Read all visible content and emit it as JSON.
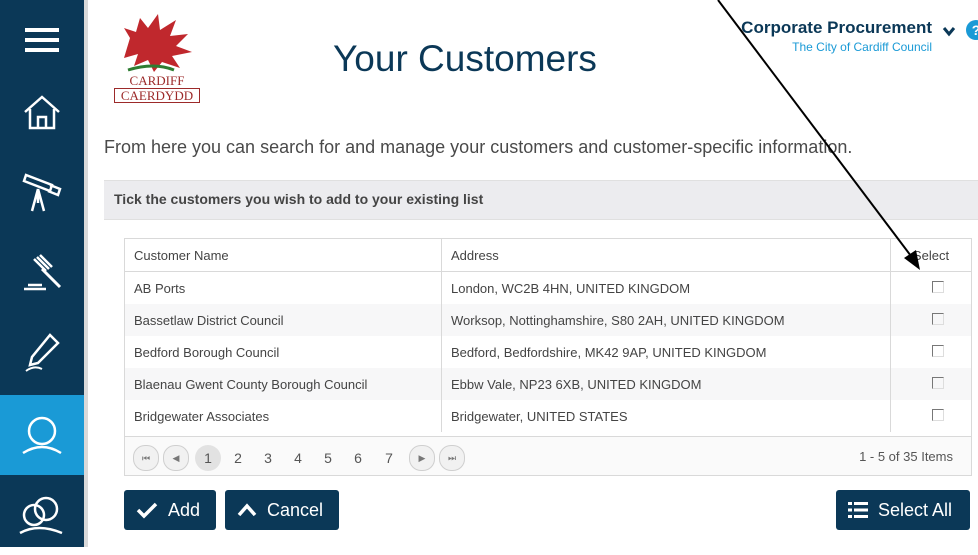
{
  "header": {
    "title": "Your Customers",
    "logo_line1": "CARDIFF",
    "logo_line2": "CAERDYDD",
    "user_name": "Corporate Procurement",
    "user_org": "The City of Cardiff Council",
    "help_glyph": "?"
  },
  "sidebar": {
    "items": [
      {
        "icon": "menu-icon"
      },
      {
        "icon": "home-icon"
      },
      {
        "icon": "telescope-icon"
      },
      {
        "icon": "gavel-icon"
      },
      {
        "icon": "pen-icon"
      },
      {
        "icon": "customer-icon",
        "active": true
      },
      {
        "icon": "customers-group-icon"
      }
    ]
  },
  "intro": "From here you can search for and manage your customers and customer-specific information.",
  "panel": {
    "heading": "Tick the customers you wish to add to your existing list"
  },
  "grid": {
    "columns": [
      "Customer Name",
      "Address",
      "Select"
    ],
    "rows": [
      {
        "name": "AB Ports",
        "address": "London, WC2B 4HN, UNITED KINGDOM"
      },
      {
        "name": "Bassetlaw District Council",
        "address": "Worksop, Nottinghamshire, S80 2AH, UNITED KINGDOM"
      },
      {
        "name": "Bedford Borough Council",
        "address": "Bedford, Bedfordshire, MK42 9AP, UNITED KINGDOM"
      },
      {
        "name": "Blaenau Gwent County Borough Council",
        "address": "Ebbw Vale, NP23 6XB, UNITED KINGDOM"
      },
      {
        "name": "Bridgewater Associates",
        "address": "Bridgewater, UNITED STATES"
      }
    ]
  },
  "pager": {
    "first": "⏮",
    "prev": "◀",
    "next": "▶",
    "last": "⏭",
    "pages": [
      "1",
      "2",
      "3",
      "4",
      "5",
      "6",
      "7"
    ],
    "current_page": "1",
    "info": "1 - 5 of 35 Items"
  },
  "actions": {
    "add_label": "Add",
    "cancel_label": "Cancel",
    "select_all_label": "Select All"
  },
  "colors": {
    "navy": "#0b3857",
    "accent": "#1a9ad6"
  }
}
